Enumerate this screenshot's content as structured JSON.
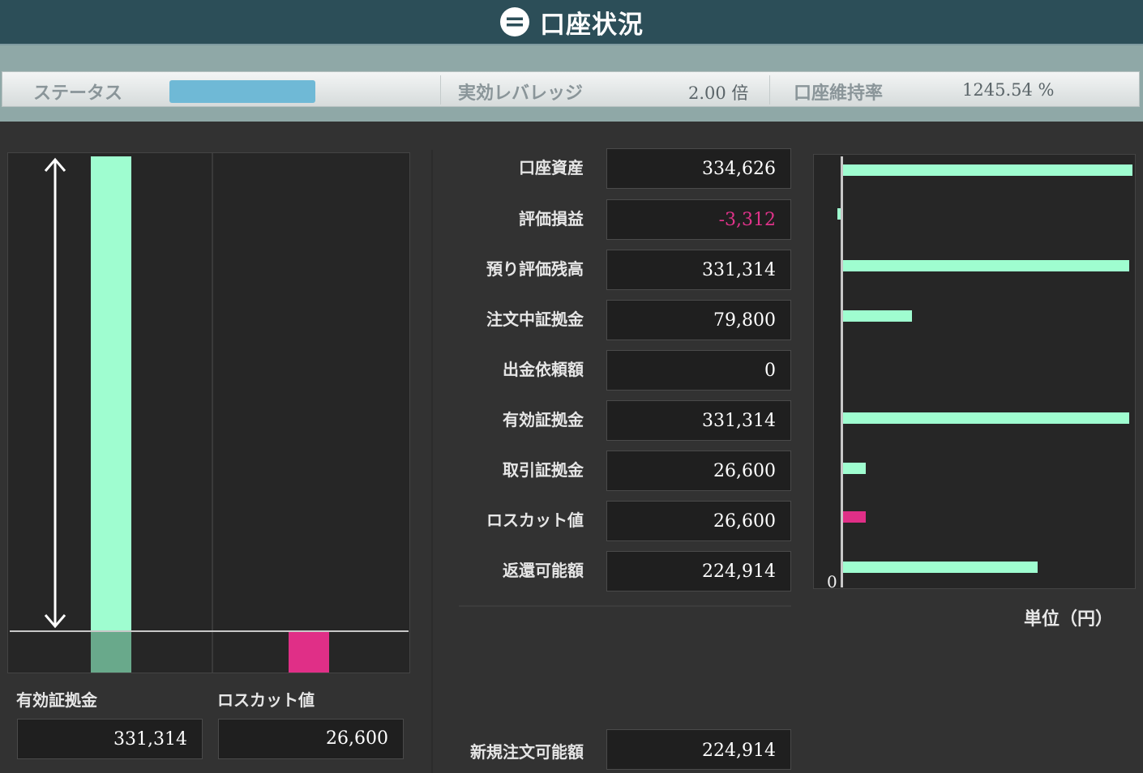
{
  "header": {
    "title": "口座状況",
    "icon": "minus-circle-icon"
  },
  "status": {
    "status_label": "ステータス",
    "status_color": "#6fb9d6",
    "leverage_label": "実効レバレッジ",
    "leverage_value": "2.00 倍",
    "margin_rate_label": "口座維持率",
    "margin_rate_value": "1245.54 %"
  },
  "left_panel": {
    "effective_margin_label": "有効証拠金",
    "effective_margin_value": "331,314",
    "loss_cut_label": "ロスカット値",
    "loss_cut_value": "26,600"
  },
  "rows": [
    {
      "label": "口座資産",
      "value": "334,626"
    },
    {
      "label": "評価損益",
      "value": "-3,312",
      "color": "#e0338a"
    },
    {
      "label": "預り評価残高",
      "value": "331,314"
    },
    {
      "label": "注文中証拠金",
      "value": "79,800"
    },
    {
      "label": "出金依頼額",
      "value": "0"
    },
    {
      "label": "有効証拠金",
      "value": "331,314"
    },
    {
      "label": "取引証拠金",
      "value": "26,600"
    },
    {
      "label": "ロスカット値",
      "value": "26,600"
    },
    {
      "label": "返還可能額",
      "value": "224,914"
    }
  ],
  "new_order": {
    "label": "新規注文可能額",
    "value": "224,914"
  },
  "chart": {
    "zero_label": "0",
    "unit_label": "単位（円）",
    "colors": {
      "positive": "#9ffdd0",
      "loss_cut": "#e02f87"
    }
  },
  "chart_data": {
    "type": "bar",
    "orientation": "horizontal",
    "categories": [
      "口座資産",
      "評価損益",
      "預り評価残高",
      "注文中証拠金",
      "出金依頼額",
      "有効証拠金",
      "取引証拠金",
      "ロスカット値",
      "返還可能額"
    ],
    "values": [
      334626,
      -3312,
      331314,
      79800,
      0,
      331314,
      26600,
      26600,
      224914
    ],
    "xlim": [
      0,
      334626
    ]
  }
}
